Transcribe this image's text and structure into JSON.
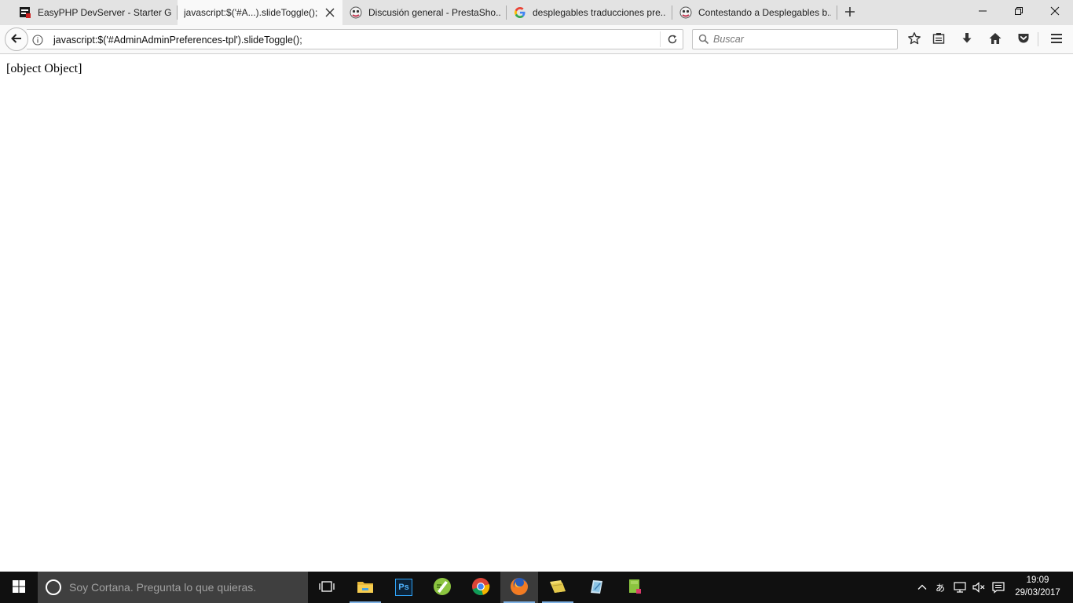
{
  "browser": {
    "tabs": [
      {
        "title": "EasyPHP DevServer - Starter G...",
        "icon": "easyphp-icon",
        "active": false
      },
      {
        "title": "javascript:$('#A...).slideToggle();",
        "icon": "",
        "active": true
      },
      {
        "title": "Discusión general - PrestaSho...",
        "icon": "prestashop-icon",
        "active": false
      },
      {
        "title": "desplegables traducciones pre...",
        "icon": "google-icon",
        "active": false
      },
      {
        "title": "Contestando a Desplegables b...",
        "icon": "prestashop-icon",
        "active": false
      }
    ],
    "new_tab_icon": "plus-icon",
    "window_controls": [
      "minimize-icon",
      "restore-icon",
      "close-icon"
    ]
  },
  "navbar": {
    "url": "javascript:$('#AdminAdminPreferences-tpl').slideToggle();",
    "search_placeholder": "Buscar",
    "toolbar_icons": [
      "star-icon",
      "reading-list-icon",
      "download-icon",
      "home-icon",
      "pocket-icon",
      "menu-icon"
    ]
  },
  "page": {
    "body_text": "[object Object]"
  },
  "taskbar": {
    "cortana_placeholder": "Soy Cortana. Pregunta lo que quieras.",
    "pinned_apps": [
      "task-view-icon",
      "file-explorer-icon",
      "photoshop-icon",
      "notepad-plus-plus-icon",
      "chrome-icon",
      "firefox-icon",
      "folder-notes-icon",
      "pencil-app-icon",
      "android-sdk-icon"
    ],
    "photoshop_label": "Ps",
    "tray_icons": [
      "show-hidden-icons-chevron",
      "ime-icon",
      "network-icon",
      "volume-muted-icon",
      "notifications-icon"
    ],
    "ime_label": "あ",
    "time": "19:09",
    "date": "29/03/2017"
  },
  "colors": {
    "tabstrip_bg": "#e3e3e3",
    "active_tab_bg": "#f9f9f9",
    "taskbar_bg": "#101010",
    "cortana_bg": "#3f3f3f",
    "running_indicator": "#7fb2e5"
  }
}
